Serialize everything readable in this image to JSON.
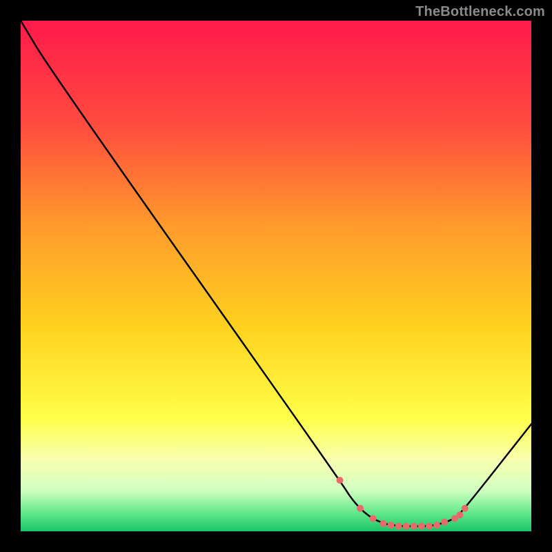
{
  "watermark": "TheBottleneck.com",
  "chart_data": {
    "type": "line",
    "title": "",
    "xlabel": "",
    "ylabel": "",
    "xlim": [
      0,
      100
    ],
    "ylim": [
      0,
      100
    ],
    "background_gradient": {
      "stops": [
        {
          "offset": 0.0,
          "color": "#ff1a4b"
        },
        {
          "offset": 0.2,
          "color": "#ff4a3f"
        },
        {
          "offset": 0.4,
          "color": "#ff9a2c"
        },
        {
          "offset": 0.6,
          "color": "#ffd21f"
        },
        {
          "offset": 0.78,
          "color": "#ffff4a"
        },
        {
          "offset": 0.86,
          "color": "#f9ffb0"
        },
        {
          "offset": 0.92,
          "color": "#d0ffc0"
        },
        {
          "offset": 0.965,
          "color": "#60e88a"
        },
        {
          "offset": 1.0,
          "color": "#19c566"
        }
      ]
    },
    "series": [
      {
        "name": "curve",
        "color": "#000000",
        "points": [
          {
            "x": 0.0,
            "y": 100.0
          },
          {
            "x": 6.0,
            "y": 90.0
          },
          {
            "x": 62.5,
            "y": 10.0
          },
          {
            "x": 65.0,
            "y": 6.0
          },
          {
            "x": 68.0,
            "y": 3.0
          },
          {
            "x": 71.0,
            "y": 1.5
          },
          {
            "x": 74.0,
            "y": 1.0
          },
          {
            "x": 77.0,
            "y": 1.0
          },
          {
            "x": 80.0,
            "y": 1.0
          },
          {
            "x": 82.5,
            "y": 1.5
          },
          {
            "x": 85.0,
            "y": 2.5
          },
          {
            "x": 87.0,
            "y": 4.5
          },
          {
            "x": 100.0,
            "y": 21.0
          }
        ]
      }
    ],
    "markers": {
      "color": "#e86a6a",
      "radius": 5,
      "points": [
        {
          "x": 62.5,
          "y": 10.0
        },
        {
          "x": 66.5,
          "y": 4.5
        },
        {
          "x": 69.0,
          "y": 2.5
        },
        {
          "x": 71.0,
          "y": 1.5
        },
        {
          "x": 72.5,
          "y": 1.2
        },
        {
          "x": 74.0,
          "y": 1.0
        },
        {
          "x": 75.5,
          "y": 1.0
        },
        {
          "x": 77.0,
          "y": 1.0
        },
        {
          "x": 78.5,
          "y": 1.0
        },
        {
          "x": 80.0,
          "y": 1.0
        },
        {
          "x": 81.5,
          "y": 1.2
        },
        {
          "x": 83.0,
          "y": 1.8
        },
        {
          "x": 85.0,
          "y": 2.5
        },
        {
          "x": 86.0,
          "y": 3.2
        },
        {
          "x": 87.0,
          "y": 4.5
        }
      ]
    }
  }
}
